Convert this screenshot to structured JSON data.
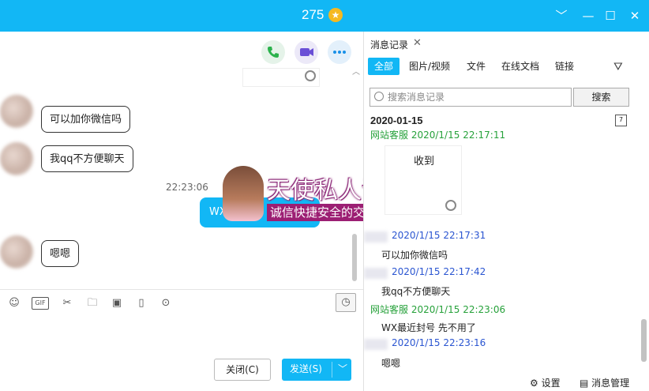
{
  "window": {
    "title": "275",
    "minimize": "﹀",
    "min": "—",
    "max": "☐",
    "close": "✕"
  },
  "chat": {
    "icons": {
      "phone": "phone-icon",
      "video": "video-icon",
      "more": "more-icon"
    },
    "messages": [
      {
        "text": "可以加你微信吗"
      },
      {
        "text": "我qq不方便聊天"
      },
      {
        "text": "嗯嗯"
      }
    ],
    "time": "22:23:06",
    "self_message": "WX",
    "toolbar": [
      "emoji-icon",
      "gif-icon",
      "scissors-icon",
      "folder-icon",
      "image-icon",
      "shake-icon",
      "more-icon"
    ],
    "gif_label": "GIF",
    "close_label": "关闭(C)",
    "send_label": "发送(S)"
  },
  "watermark": {
    "line1": "天使私人订制",
    "line2": "诚信快捷安全的交友平台"
  },
  "panel": {
    "tab_title": "消息记录",
    "filters": [
      "全部",
      "图片/视频",
      "文件",
      "在线文档",
      "链接"
    ],
    "search_placeholder": "搜索消息记录",
    "search_button": "搜索",
    "date": "2020-01-15",
    "history": [
      {
        "sender": "网站客服",
        "time": "2020/1/15 22:17:11",
        "text": "收到"
      },
      {
        "sender": "",
        "time": "2020/1/15 22:17:31",
        "text": "可以加你微信吗"
      },
      {
        "sender": "",
        "time": "2020/1/15 22:17:42",
        "text": "我qq不方便聊天"
      },
      {
        "sender": "网站客服",
        "time": "2020/1/15 22:23:06",
        "text": "WX最近封号 先不用了"
      },
      {
        "sender": "",
        "time": "2020/1/15 22:23:16",
        "text": "嗯嗯"
      }
    ],
    "settings": "设置",
    "manage": "消息管理"
  }
}
